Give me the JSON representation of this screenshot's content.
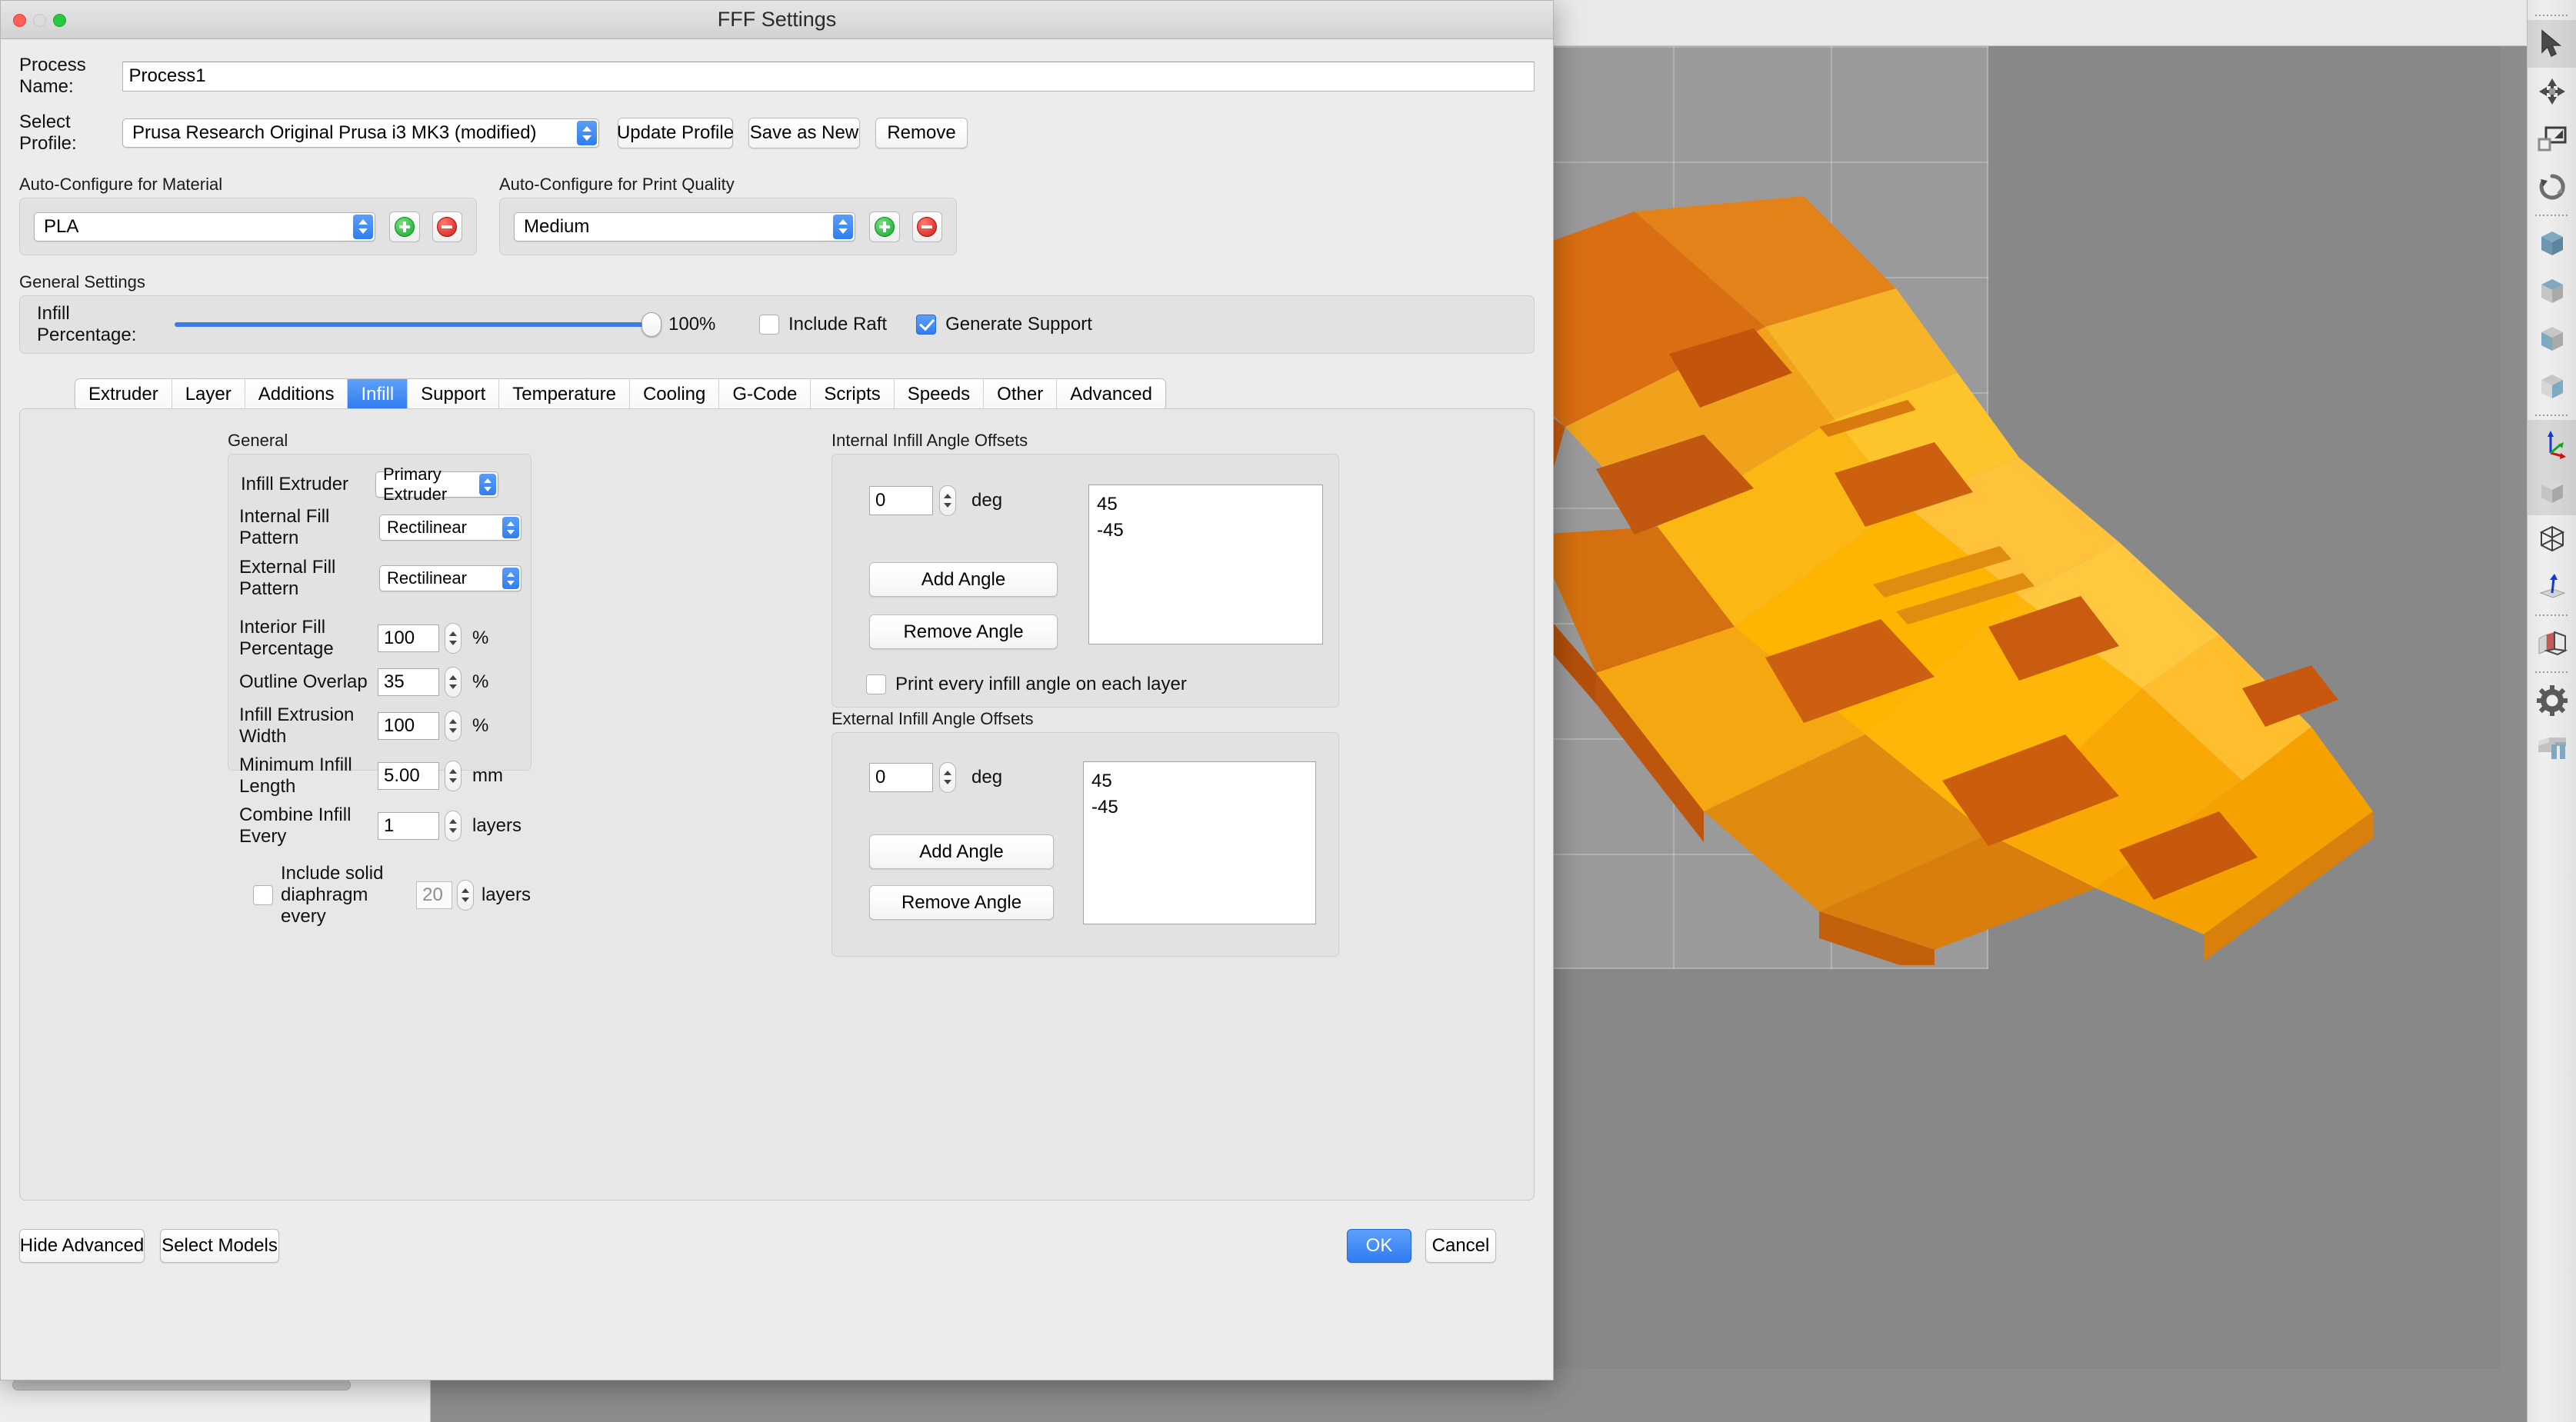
{
  "window": {
    "title": "FFF Settings",
    "traffic_lights": [
      "close",
      "minimize",
      "zoom"
    ]
  },
  "form": {
    "process_name_label": "Process Name:",
    "process_name_value": "Process1",
    "select_profile_label": "Select Profile:",
    "select_profile_value": "Prusa Research Original Prusa i3 MK3 (modified)",
    "update_profile_label": "Update Profile",
    "save_as_new_label": "Save as New",
    "remove_label": "Remove"
  },
  "auto_material": {
    "title": "Auto-Configure for Material",
    "value": "PLA",
    "add_label": "+",
    "remove_label": "−"
  },
  "auto_quality": {
    "title": "Auto-Configure for Print Quality",
    "value": "Medium",
    "add_label": "+",
    "remove_label": "−"
  },
  "general_settings": {
    "title": "General Settings",
    "infill_label": "Infill Percentage:",
    "infill_value": "100%",
    "infill_percent": 100,
    "include_raft_label": "Include Raft",
    "include_raft_checked": false,
    "generate_support_label": "Generate Support",
    "generate_support_checked": true
  },
  "tabs": [
    {
      "label": "Extruder",
      "active": false
    },
    {
      "label": "Layer",
      "active": false
    },
    {
      "label": "Additions",
      "active": false
    },
    {
      "label": "Infill",
      "active": true
    },
    {
      "label": "Support",
      "active": false
    },
    {
      "label": "Temperature",
      "active": false
    },
    {
      "label": "Cooling",
      "active": false
    },
    {
      "label": "G-Code",
      "active": false
    },
    {
      "label": "Scripts",
      "active": false
    },
    {
      "label": "Speeds",
      "active": false
    },
    {
      "label": "Other",
      "active": false
    },
    {
      "label": "Advanced",
      "active": false
    }
  ],
  "infill_general": {
    "title": "General",
    "infill_extruder_label": "Infill Extruder",
    "infill_extruder_value": "Primary Extruder",
    "internal_fill_pattern_label": "Internal Fill Pattern",
    "internal_fill_pattern_value": "Rectilinear",
    "external_fill_pattern_label": "External Fill Pattern",
    "external_fill_pattern_value": "Rectilinear",
    "interior_fill_percentage_label": "Interior Fill Percentage",
    "interior_fill_percentage_value": "100",
    "interior_fill_percentage_unit": "%",
    "outline_overlap_label": "Outline Overlap",
    "outline_overlap_value": "35",
    "outline_overlap_unit": "%",
    "infill_extrusion_width_label": "Infill Extrusion Width",
    "infill_extrusion_width_value": "100",
    "infill_extrusion_width_unit": "%",
    "minimum_infill_length_label": "Minimum Infill Length",
    "minimum_infill_length_value": "5.00",
    "minimum_infill_length_unit": "mm",
    "combine_infill_every_label": "Combine Infill Every",
    "combine_infill_every_value": "1",
    "combine_infill_every_unit": "layers",
    "solid_diaphragm_label": "Include solid diaphragm every",
    "solid_diaphragm_checked": false,
    "solid_diaphragm_value": "20",
    "solid_diaphragm_unit": "layers"
  },
  "internal_angles": {
    "title": "Internal Infill Angle Offsets",
    "deg_value": "0",
    "deg_unit": "deg",
    "add_angle_label": "Add Angle",
    "remove_angle_label": "Remove Angle",
    "angles": [
      "45",
      "-45"
    ],
    "print_every_label": "Print every infill angle on each layer",
    "print_every_checked": false
  },
  "external_angles": {
    "title": "External Infill Angle Offsets",
    "deg_value": "0",
    "deg_unit": "deg",
    "add_angle_label": "Add Angle",
    "remove_angle_label": "Remove Angle",
    "angles": [
      "45",
      "-45"
    ]
  },
  "footer": {
    "hide_advanced_label": "Hide Advanced",
    "select_models_label": "Select Models",
    "ok_label": "OK",
    "cancel_label": "Cancel"
  },
  "toolbar": {
    "items": [
      {
        "name": "select-tool",
        "active": true
      },
      {
        "name": "move-tool",
        "active": false
      },
      {
        "name": "scale-tool",
        "active": false
      },
      {
        "name": "rotate-tool",
        "active": false
      },
      {
        "separator_after": true
      },
      {
        "name": "view-home",
        "active": false
      },
      {
        "name": "view-top",
        "active": false
      },
      {
        "name": "view-front",
        "active": false
      },
      {
        "name": "view-side",
        "active": false
      },
      {
        "separator_after": true
      },
      {
        "name": "view-axes",
        "active": true
      },
      {
        "name": "view-solid",
        "active": true
      },
      {
        "name": "view-wireframe",
        "active": false
      },
      {
        "name": "view-normals",
        "active": false
      },
      {
        "separator_after": true
      },
      {
        "name": "cross-section",
        "active": false
      },
      {
        "separator_after": true
      },
      {
        "name": "settings-gear",
        "active": false
      },
      {
        "name": "support-structures",
        "active": false
      }
    ]
  },
  "colors": {
    "accent": "#2f7cf0",
    "model_orange": "#f6a000",
    "model_orange_dark": "#cc5a14",
    "green": "#16a82b",
    "red": "#d01b16"
  }
}
